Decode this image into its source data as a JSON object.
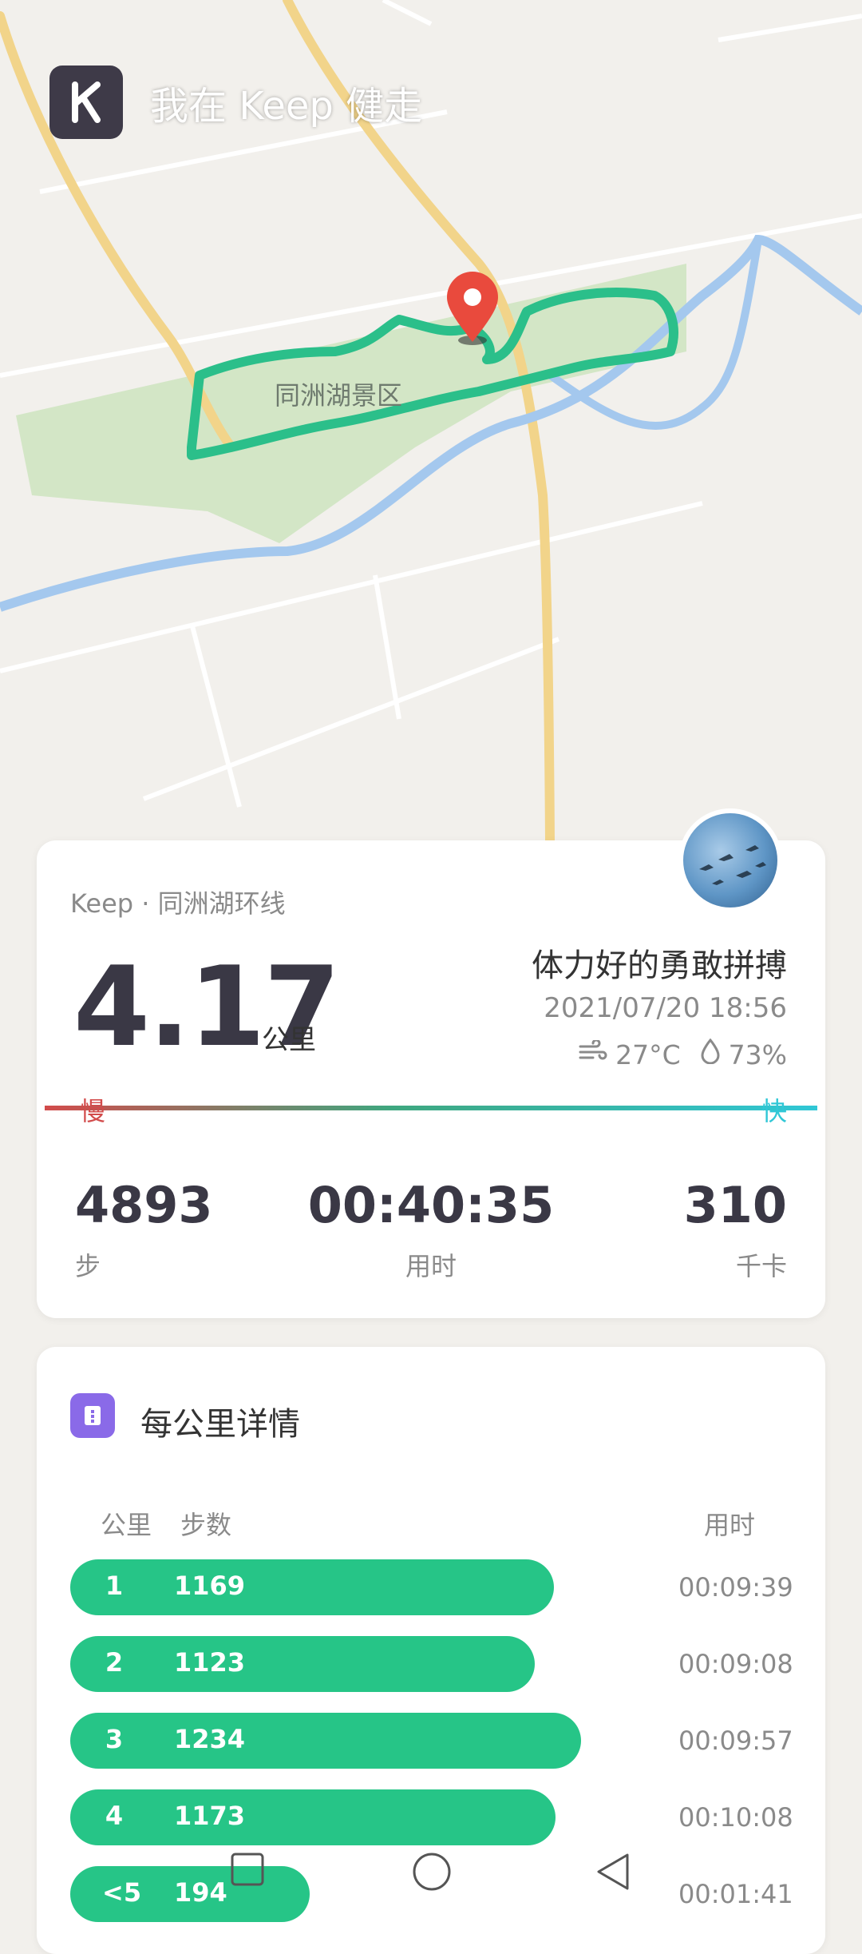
{
  "app": {
    "title": "我在 Keep 健走",
    "map_label": "同洲湖景区"
  },
  "summary": {
    "route": "Keep · 同洲湖环线",
    "distance": "4.17",
    "distance_unit": "公里",
    "title": "体力好的勇敢拼搏",
    "datetime": "2021/07/20 18:56",
    "temperature": "27°C",
    "humidity": "73%",
    "speed_slow_label": "慢",
    "speed_fast_label": "快",
    "stats": [
      {
        "value": "4893",
        "label": "步"
      },
      {
        "value": "00:40:35",
        "label": "用时"
      },
      {
        "value": "310",
        "label": "千卡"
      }
    ]
  },
  "per_km": {
    "title": "每公里详情",
    "headers": {
      "km": "公里",
      "steps": "步数",
      "time": "用时"
    },
    "rows": [
      {
        "km": "1",
        "steps": "1169",
        "time": "00:09:39",
        "steps_num": 1169
      },
      {
        "km": "2",
        "steps": "1123",
        "time": "00:09:08",
        "steps_num": 1123
      },
      {
        "km": "3",
        "steps": "1234",
        "time": "00:09:57",
        "steps_num": 1234
      },
      {
        "km": "4",
        "steps": "1173",
        "time": "00:10:08",
        "steps_num": 1173
      },
      {
        "km": "<5",
        "steps": "194",
        "time": "00:01:41",
        "steps_num": 194
      }
    ]
  },
  "colors": {
    "bar": "#26c587",
    "slow": "#d24b4b",
    "fast": "#30c7d6",
    "route": "#2bbf8a"
  },
  "icons": [
    "keep-logo",
    "location-pin-icon",
    "wind-icon",
    "humidity-icon",
    "list-icon",
    "nav-square-icon",
    "nav-home-icon",
    "nav-back-icon"
  ]
}
